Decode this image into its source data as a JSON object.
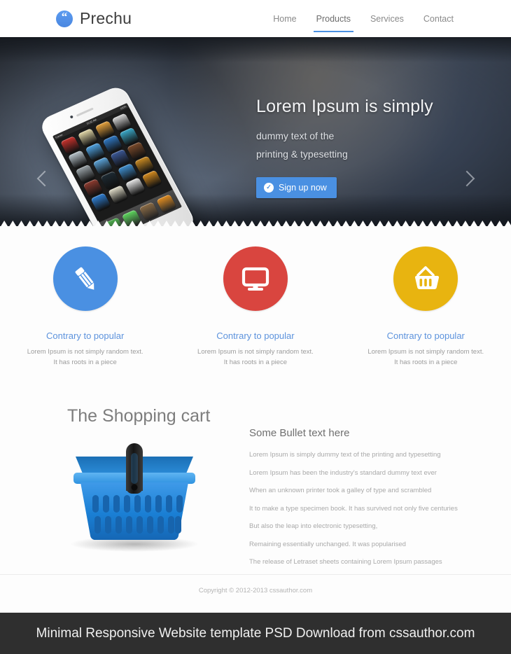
{
  "header": {
    "logo": {
      "glyph": "“",
      "icon_name": "quote-logo-icon",
      "text": "Prechu",
      "color": "#4a87e0"
    },
    "nav": [
      {
        "label": "Home",
        "active": false
      },
      {
        "label": "Products",
        "active": true
      },
      {
        "label": "Services",
        "active": false
      },
      {
        "label": "Contact",
        "active": false
      }
    ],
    "accent_color": "#4a90e2"
  },
  "hero": {
    "heading": "Lorem Ipsum is simply",
    "sub_line1": "dummy text of the",
    "sub_line2": "printing & typesetting",
    "cta_label": "Sign up now",
    "cta_icon": "check-circle-icon",
    "cta_color": "#4a90e2",
    "prev_arrow": "chevron-left-icon",
    "next_arrow": "chevron-right-icon",
    "phone": {
      "status_left": "Carrier",
      "status_center": "10:32 AM",
      "status_right": "100%",
      "app_colors": [
        "#c9322c",
        "#e4d9a8",
        "#e8a33d",
        "#d6d6d6",
        "#b8c4cc",
        "#4fa3e3",
        "#2f78c4",
        "#3aa9c9",
        "#9aa3a8",
        "#5ba3d9",
        "#3b5998",
        "#7a4a2a",
        "#8e3b2f",
        "#1d2a33",
        "#3f8fd0",
        "#c98a22",
        "#2f7fd4",
        "#e0dcc8",
        "#e6e6e6",
        "#d78c1e"
      ],
      "dock_colors": [
        "#4cae4c",
        "#5cd65c",
        "#8a6a43",
        "#e08b1e"
      ]
    }
  },
  "features": [
    {
      "icon": "pencil-icon",
      "color": "#4a90e2",
      "title": "Contrary to popular",
      "body_line1": "Lorem Ipsum is not simply random text.",
      "body_line2": "It has roots in a piece"
    },
    {
      "icon": "monitor-icon",
      "color": "#d9453f",
      "title": "Contrary to popular",
      "body_line1": "Lorem Ipsum is not simply random text.",
      "body_line2": "It has roots in a piece"
    },
    {
      "icon": "shopping-basket-icon",
      "color": "#e8b410",
      "title": "Contrary to popular",
      "body_line1": "Lorem Ipsum is not simply random text.",
      "body_line2": "It has roots in a piece"
    }
  ],
  "cart_section": {
    "title": "The Shopping cart",
    "image_name": "blue-shopping-basket-illustration",
    "bullets_heading": "Some Bullet text here",
    "bullets": [
      "Lorem Ipsum is simply dummy text of the printing and typesetting",
      "Lorem Ipsum has been the industry's standard dummy text ever",
      "When an unknown printer took a galley of type and scrambled",
      "It to make a type specimen book. It has survived not only five centuries",
      "But also the leap into electronic typesetting,",
      "Remaining essentially unchanged. It was popularised",
      "The release of Letraset sheets containing Lorem Ipsum passages"
    ]
  },
  "footer": {
    "copyright": "Copyright © 2012-2013 cssauthor.com",
    "caption": "Minimal Responsive Website template PSD Download from cssauthor.com",
    "caption_bg": "#2f2f2f"
  }
}
